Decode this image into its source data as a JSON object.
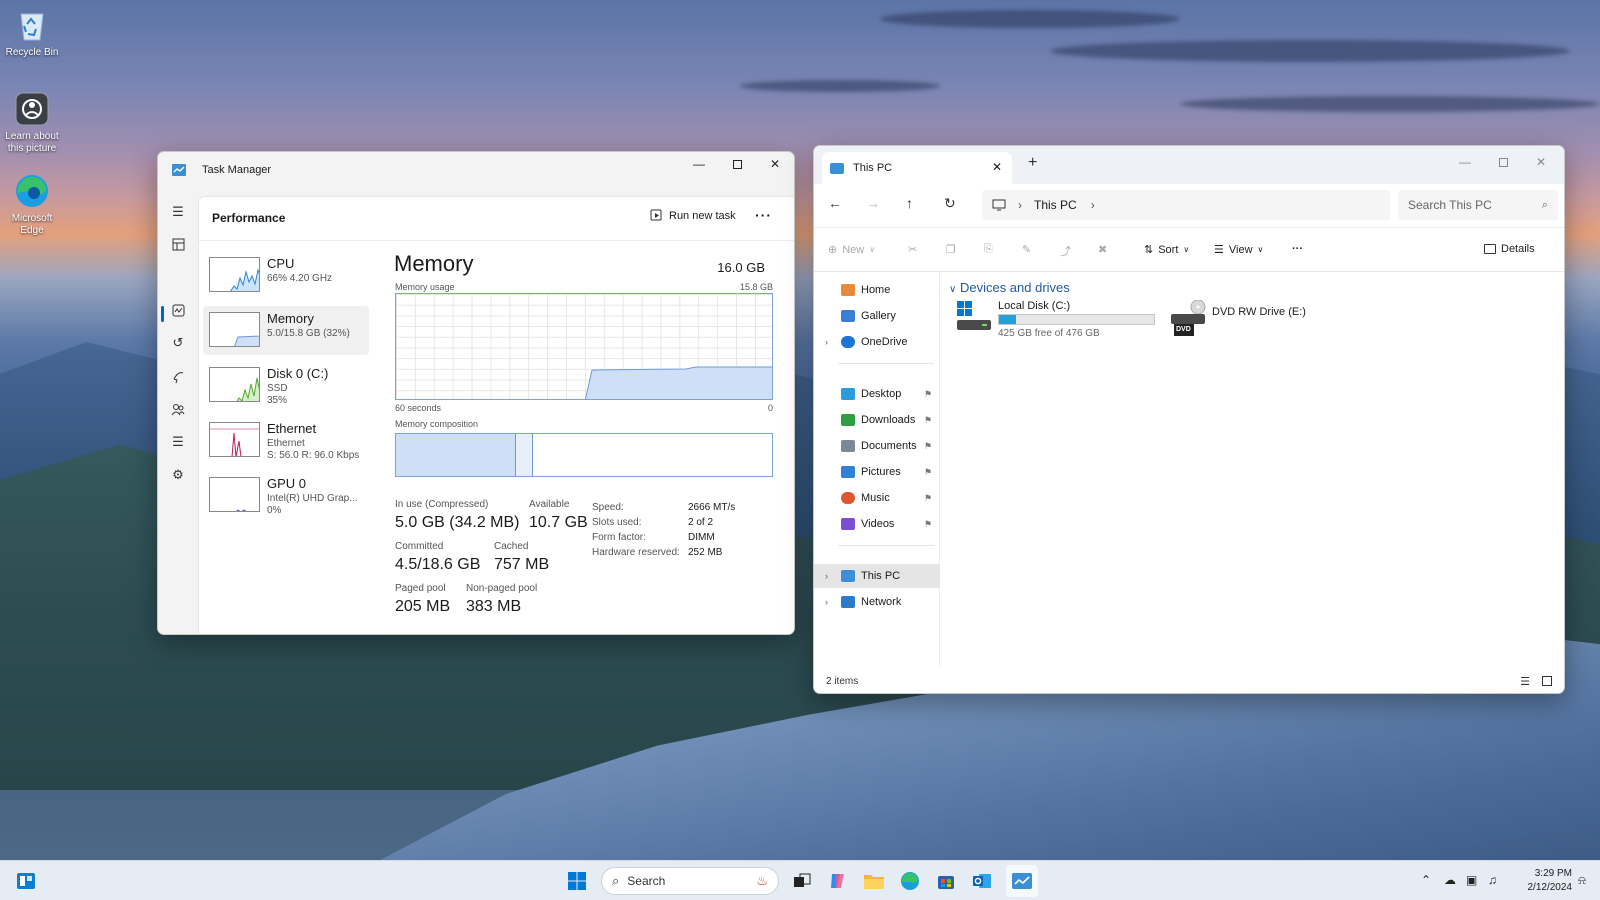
{
  "desktop": {
    "icons": [
      {
        "label": "Recycle Bin"
      },
      {
        "label": "Learn about this picture"
      },
      {
        "label": "Microsoft Edge"
      }
    ]
  },
  "task_manager": {
    "title": "Task Manager",
    "section": "Performance",
    "run_new_task": "Run new task",
    "more": "···",
    "resources": [
      {
        "name": "CPU",
        "sub": "66% 4.20 GHz"
      },
      {
        "name": "Memory",
        "sub": "5.0/15.8 GB (32%)"
      },
      {
        "name": "Disk 0 (C:)",
        "sub": "SSD",
        "sub2": "35%"
      },
      {
        "name": "Ethernet",
        "sub": "Ethernet",
        "sub2": "S: 56.0 R: 96.0 Kbps"
      },
      {
        "name": "GPU 0",
        "sub": "Intel(R) UHD Grap...",
        "sub2": "0%"
      }
    ],
    "memory": {
      "title": "Memory",
      "total": "16.0 GB",
      "usage_label": "Memory usage",
      "usage_max": "15.8 GB",
      "time_left": "60 seconds",
      "time_right": "0",
      "composition_label": "Memory composition",
      "in_use_label": "In use (Compressed)",
      "in_use": "5.0 GB (34.2 MB)",
      "available_label": "Available",
      "available": "10.7 GB",
      "committed_label": "Committed",
      "committed": "4.5/18.6 GB",
      "cached_label": "Cached",
      "cached": "757 MB",
      "paged_label": "Paged pool",
      "paged": "205 MB",
      "nonpaged_label": "Non-paged pool",
      "nonpaged": "383 MB",
      "details": [
        {
          "k": "Speed:",
          "v": "2666 MT/s"
        },
        {
          "k": "Slots used:",
          "v": "2 of 2"
        },
        {
          "k": "Form factor:",
          "v": "DIMM"
        },
        {
          "k": "Hardware reserved:",
          "v": "252 MB"
        }
      ],
      "composition": {
        "in_use_fraction": 0.32,
        "modified_fraction": 0.045
      }
    },
    "colors": {
      "accent": "#0067c0",
      "memory_fill": "#cfe0f6",
      "memory_line": "#6d9ad3",
      "cpu": "#2b87d8",
      "disk": "#4ea72e",
      "ethernet": "#c2185b",
      "gpu": "#8c4fc6"
    }
  },
  "file_explorer": {
    "tab_title": "This PC",
    "breadcrumb": "This PC",
    "search_placeholder": "Search This PC",
    "commands": {
      "new": "New",
      "sort": "Sort",
      "view": "View",
      "more": "···",
      "details": "Details"
    },
    "nav": {
      "home": "Home",
      "gallery": "Gallery",
      "onedrive": "OneDrive",
      "desktop": "Desktop",
      "downloads": "Downloads",
      "documents": "Documents",
      "pictures": "Pictures",
      "music": "Music",
      "videos": "Videos",
      "this_pc": "This PC",
      "network": "Network"
    },
    "group_title": "Devices and drives",
    "drives": [
      {
        "name": "Local Disk (C:)",
        "free": "425 GB free of 476 GB",
        "used_fraction": 0.107
      },
      {
        "name": "DVD RW Drive (E:)",
        "badge": "DVD"
      }
    ],
    "status": "2 items"
  },
  "taskbar": {
    "search_label": "Search",
    "time": "3:29 PM",
    "date": "2/12/2024"
  }
}
